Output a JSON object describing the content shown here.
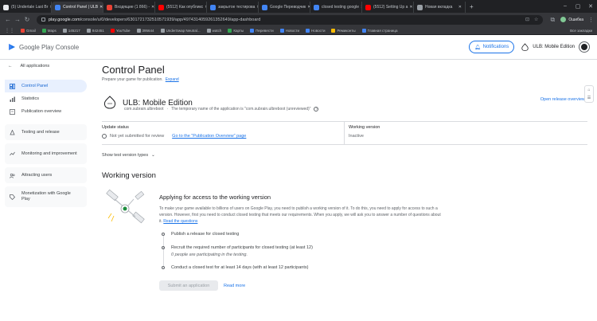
{
  "browser": {
    "tabs": [
      {
        "title": "(5) Undertale Last Br",
        "color": "#e8eaed",
        "active": false
      },
      {
        "title": "Control Panel | ULB",
        "color": "#4285f4",
        "active": true
      },
      {
        "title": "Входящие (1 866) -",
        "color": "#ea4335",
        "active": false
      },
      {
        "title": "(5512) Как опубликс",
        "color": "#ff0000",
        "active": false
      },
      {
        "title": "закрытое тестирова",
        "color": "#4285f4",
        "active": false
      },
      {
        "title": "Google Переводчик",
        "color": "#4285f4",
        "active": false
      },
      {
        "title": "closed testing google",
        "color": "#4285f4",
        "active": false
      },
      {
        "title": "(5512) Setting Up a",
        "color": "#ff0000",
        "active": false
      },
      {
        "title": "Новая вкладка",
        "color": "#9aa0a6",
        "active": false
      }
    ],
    "new_tab": "+",
    "url_domain": "play.google.com",
    "url_path": "/console/u/0/developers/6301721732510571939/app/4974314059261352649/app-dashboard",
    "profile_label": "Ошибка",
    "bookmarks": [
      {
        "label": "Gmail",
        "color": "#ea4335"
      },
      {
        "label": "Maps",
        "color": "#34a853"
      },
      {
        "label": "145217",
        "color": "#9aa0a6"
      },
      {
        "label": "842451",
        "color": "#9aa0a6"
      },
      {
        "label": "YouTube",
        "color": "#ff0000"
      },
      {
        "label": "395644",
        "color": "#9aa0a6"
      },
      {
        "label": "UnderSwap Neutral...",
        "color": "#9aa0a6"
      },
      {
        "label": "watch",
        "color": "#9aa0a6"
      },
      {
        "label": "Карты",
        "color": "#34a853"
      },
      {
        "label": "Перевести",
        "color": "#4285f4"
      },
      {
        "label": "Новости",
        "color": "#4285f4"
      },
      {
        "label": "Новости",
        "color": "#4285f4"
      },
      {
        "label": "Ремиконты",
        "color": "#fbbc04"
      },
      {
        "label": "Главная страница",
        "color": "#4285f4"
      }
    ],
    "all_bookmarks": "Все закладки"
  },
  "header": {
    "brand": "Google Play Console",
    "notifications": "Notifications",
    "app_chip": "ULB: Mobile Edition"
  },
  "sidebar": {
    "back": "All applications",
    "items": [
      {
        "label": "Control Panel",
        "icon": "dashboard-icon",
        "active": true
      },
      {
        "label": "Statistics",
        "icon": "bar-chart-icon",
        "active": false
      },
      {
        "label": "Publication overview",
        "icon": "overview-icon",
        "active": false
      }
    ],
    "sections": [
      {
        "label": "Testing and release",
        "icon": "rocket-icon"
      },
      {
        "label": "Monitoring and improvement",
        "icon": "monitoring-icon"
      },
      {
        "label": "Attracting users",
        "icon": "users-icon"
      },
      {
        "label": "Monetization with Google Play",
        "icon": "tag-icon"
      }
    ]
  },
  "main": {
    "title": "Control Panel",
    "subtitle": "Prepare your game for publication.",
    "expand": "Expand",
    "app_name": "ULB: Mobile Edition",
    "package": "com.subrain.ulbreboot",
    "package_sep": "·",
    "temp_name": "The temporary name of the application is \"com.subrain.ulbreboot (unreviewed)\"",
    "open_release": "Open release overview",
    "update_status_label": "Update status",
    "update_status_value": "Not yet submitted for review",
    "update_status_link": "Go to the \"Publication Overview\" page",
    "working_version_label": "Working version",
    "working_version_value": "Inactive",
    "show_types": "Show test version types",
    "section_title": "Working version",
    "apply_title": "Applying for access to the working version",
    "apply_desc": "To make your game available to billions of users on Google Play, you need to publish a working version of it. To do this, you need to apply for access to such a version. However, first you need to conduct closed testing that meets our requirements. When you apply, we will ask you to answer a number of questions about it.",
    "read_questions": "Read the questions",
    "steps": [
      {
        "label": "Publish a release for closed testing",
        "note": ""
      },
      {
        "label": "Recruit the required number of participants for closed testing (at least 12)",
        "note": "0 people are participating in the testing."
      },
      {
        "label": "Conduct a closed test for at least 14 days (with at least 12 participants)",
        "note": ""
      }
    ],
    "submit": "Submit an application",
    "read_more": "Read more"
  }
}
